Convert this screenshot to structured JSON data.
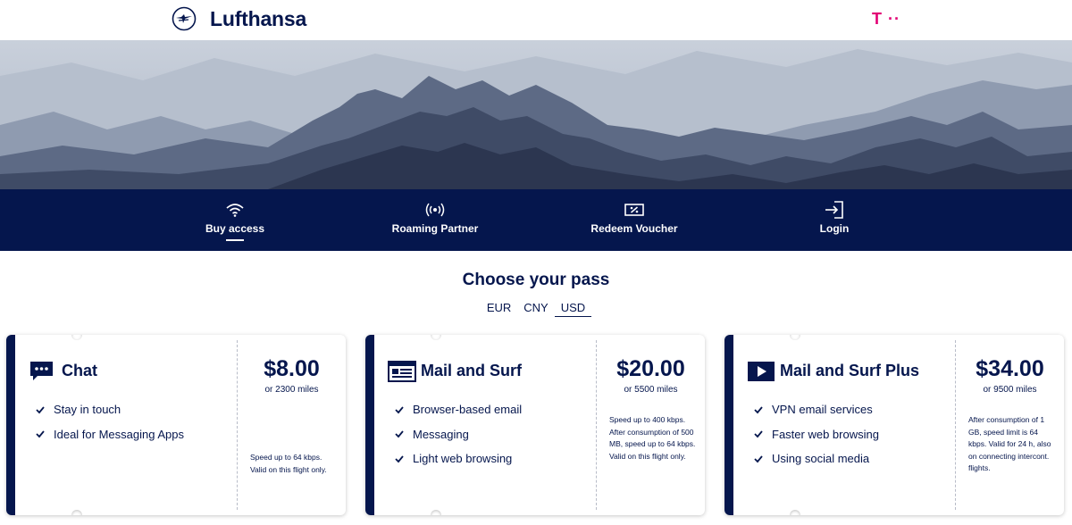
{
  "header": {
    "brand_name": "Lufthansa",
    "partner_logo": "T ··"
  },
  "nav": {
    "items": [
      {
        "label": "Buy access",
        "icon": "wifi-icon",
        "active": true
      },
      {
        "label": "Roaming Partner",
        "icon": "roaming-icon",
        "active": false
      },
      {
        "label": "Redeem Voucher",
        "icon": "voucher-icon",
        "active": false
      },
      {
        "label": "Login",
        "icon": "login-icon",
        "active": false
      }
    ]
  },
  "main": {
    "title": "Choose your pass",
    "currencies": [
      "EUR",
      "CNY",
      "USD"
    ],
    "selected_currency": "USD"
  },
  "passes": [
    {
      "name": "Chat",
      "icon": "chat-bubble-icon",
      "features": [
        "Stay in touch",
        "Ideal for Messaging Apps"
      ],
      "price": "$8.00",
      "miles": "or 2300 miles",
      "note": "Speed up to 64 kbps. Valid on this flight only."
    },
    {
      "name": "Mail and Surf",
      "icon": "browser-window-icon",
      "features": [
        "Browser-based email",
        "Messaging",
        "Light web browsing"
      ],
      "price": "$20.00",
      "miles": "or 5500 miles",
      "note": "Speed up to 400 kbps. After consumption of 500 MB, speed up to 64 kbps. Valid on this flight only."
    },
    {
      "name": "Mail and Surf Plus",
      "icon": "play-icon",
      "features": [
        "VPN email services",
        "Faster web browsing",
        "Using social media"
      ],
      "price": "$34.00",
      "miles": "or 9500 miles",
      "note": "After consumption of 1 GB, speed limit is 64 kbps. Valid for 24 h, also on connecting intercont. flights."
    }
  ],
  "colors": {
    "brand_navy": "#05164d",
    "telekom_magenta": "#e20074"
  }
}
